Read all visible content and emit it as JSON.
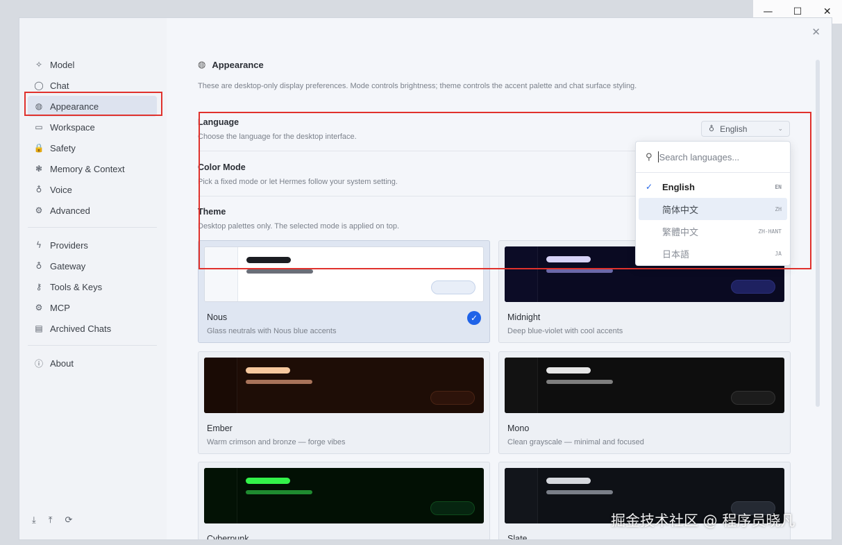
{
  "window": {
    "minimize_icon": "minimize-icon",
    "maximize_icon": "maximize-icon",
    "close_icon": "close-icon",
    "minimize_glyph": "—",
    "maximize_glyph": "☐",
    "close_glyph": "✕"
  },
  "dialog": {
    "close_glyph": "✕"
  },
  "sidebar": {
    "group1": [
      {
        "label": "Model",
        "icon": "sparkle-icon",
        "glyph": "✧"
      },
      {
        "label": "Chat",
        "icon": "chat-bubble-icon",
        "glyph": "◯"
      },
      {
        "label": "Appearance",
        "icon": "palette-icon",
        "glyph": "◍",
        "active": true
      },
      {
        "label": "Workspace",
        "icon": "monitor-icon",
        "glyph": "▭"
      },
      {
        "label": "Safety",
        "icon": "lock-icon",
        "glyph": "🔒"
      },
      {
        "label": "Memory & Context",
        "icon": "brain-icon",
        "glyph": "❃"
      },
      {
        "label": "Voice",
        "icon": "microphone-icon",
        "glyph": "♁"
      },
      {
        "label": "Advanced",
        "icon": "wrench-icon",
        "glyph": "⚙"
      }
    ],
    "group2": [
      {
        "label": "Providers",
        "icon": "lightning-icon",
        "glyph": "ϟ"
      },
      {
        "label": "Gateway",
        "icon": "balloon-icon",
        "glyph": "♁"
      },
      {
        "label": "Tools & Keys",
        "icon": "key-icon",
        "glyph": "⚷"
      },
      {
        "label": "MCP",
        "icon": "plug-icon",
        "glyph": "⚙"
      },
      {
        "label": "Archived Chats",
        "icon": "archive-icon",
        "glyph": "▤"
      }
    ],
    "group3": [
      {
        "label": "About",
        "icon": "info-icon",
        "glyph": "ⓘ"
      }
    ],
    "bottom_icons": [
      {
        "name": "download-icon",
        "glyph": "⤓"
      },
      {
        "name": "upload-icon",
        "glyph": "⤒"
      },
      {
        "name": "refresh-icon",
        "glyph": "⟳"
      }
    ]
  },
  "main": {
    "title": "Appearance",
    "title_glyph": "◍",
    "description": "These are desktop-only display preferences. Mode controls brightness; theme controls the accent palette and chat surface styling.",
    "language": {
      "label": "Language",
      "sub": "Choose the language for the desktop interface.",
      "selected": "English",
      "icon_glyph": "♁",
      "chevron_glyph": "⌄"
    },
    "color_mode": {
      "label": "Color Mode",
      "sub": "Pick a fixed mode or let Hermes follow your system setting."
    },
    "theme": {
      "label": "Theme",
      "sub": "Desktop palettes only. The selected mode is applied on top."
    }
  },
  "themes": [
    {
      "name": "Nous",
      "sub": "Glass neutrals with Nous blue accents",
      "selected": true,
      "colors": {
        "bg": "#ffffff",
        "side": "#f6f8fb",
        "bar1": "#1b1d22",
        "bar2": "#6a6e78",
        "pill": "#e8eef8",
        "pill_border": "#c5d3ea"
      }
    },
    {
      "name": "Midnight",
      "sub": "Deep blue-violet with cool accents",
      "selected": false,
      "colors": {
        "bg": "#0a0a22",
        "side": "#0c0c26",
        "bar1": "#d6d2f6",
        "bar2": "#6c68a8",
        "pill": "#1e2160",
        "pill_border": "#2b2f78"
      }
    },
    {
      "name": "Ember",
      "sub": "Warm crimson and bronze — forge vibes",
      "selected": false,
      "colors": {
        "bg": "#1e0d06",
        "side": "#1a0b05",
        "bar1": "#f6c89e",
        "bar2": "#a8735a",
        "pill": "#2d130a",
        "pill_border": "#4a2414"
      }
    },
    {
      "name": "Mono",
      "sub": "Clean grayscale — minimal and focused",
      "selected": false,
      "colors": {
        "bg": "#0e0e0e",
        "side": "#121212",
        "bar1": "#e7e7e7",
        "bar2": "#7e7e7e",
        "pill": "#1c1c1c",
        "pill_border": "#333333"
      }
    },
    {
      "name": "Cyberpunk",
      "sub": "",
      "selected": false,
      "colors": {
        "bg": "#021004",
        "side": "#031205",
        "bar1": "#33f24a",
        "bar2": "#1f8a30",
        "pill": "#062510",
        "pill_border": "#0f4a1c"
      }
    },
    {
      "name": "Slate",
      "sub": "",
      "selected": false,
      "colors": {
        "bg": "#0e1116",
        "side": "#12151b",
        "bar1": "#d6d9de",
        "bar2": "#7a7f88",
        "pill": "#252a33",
        "pill_border": "#363c47"
      }
    }
  ],
  "language_popup": {
    "search_placeholder": "Search languages...",
    "search_glyph": "⚲",
    "check_glyph": "✓",
    "options": [
      {
        "label": "English",
        "code": "EN",
        "state": "active"
      },
      {
        "label": "简体中文",
        "code": "ZH",
        "state": "hl"
      },
      {
        "label": "繁體中文",
        "code": "ZH-HANT",
        "state": "dim"
      },
      {
        "label": "日本語",
        "code": "JA",
        "state": "dim"
      }
    ]
  },
  "card_check_glyph": "✓",
  "watermark": "掘金技术社区 @ 程序员晓凡"
}
